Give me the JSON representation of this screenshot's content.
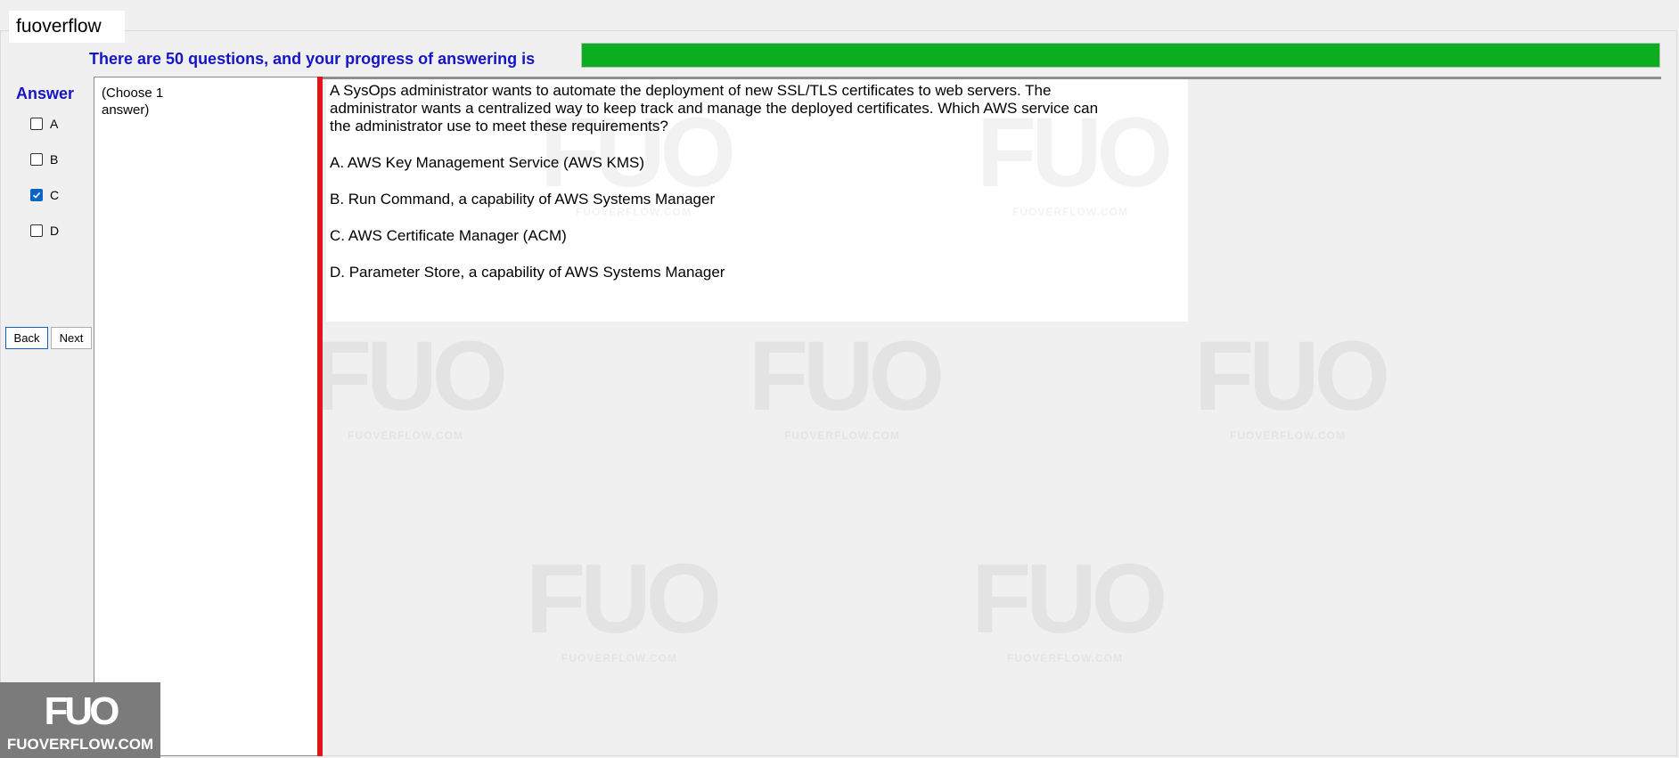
{
  "app": {
    "title": "fuoverflow"
  },
  "progress": {
    "label": "There are 50 questions, and your progress of answering is",
    "value_percent": 100,
    "color": "#0aae1e"
  },
  "answer_panel": {
    "title": "Answer",
    "options": [
      {
        "label": "A",
        "checked": false
      },
      {
        "label": "B",
        "checked": false
      },
      {
        "label": "C",
        "checked": true
      },
      {
        "label": "D",
        "checked": false
      }
    ]
  },
  "nav": {
    "back_label": "Back",
    "next_label": "Next"
  },
  "instruction": "(Choose 1 answer)",
  "question": {
    "text": "A SysOps administrator wants to automate the deployment of new SSL/TLS certificates to web servers. The administrator wants a centralized way to keep track and manage the deployed certificates. Which AWS service can the administrator use to meet these requirements?",
    "choices": [
      "A.  AWS Key Management Service (AWS KMS)",
      "B.  Run Command, a capability of AWS Systems Manager",
      "C.  AWS Certificate Manager (ACM)",
      "D.  Parameter Store, a capability of AWS Systems Manager"
    ]
  },
  "watermark": {
    "mark": "FUO",
    "site": "FUOVERFLOW.COM"
  },
  "corner_logo": {
    "mark": "FUO",
    "site": "FUOVERFLOW.COM"
  },
  "colors": {
    "accent_blue": "#1515c8",
    "divider_red": "#e0161b",
    "checkbox_blue": "#0b63c5"
  }
}
